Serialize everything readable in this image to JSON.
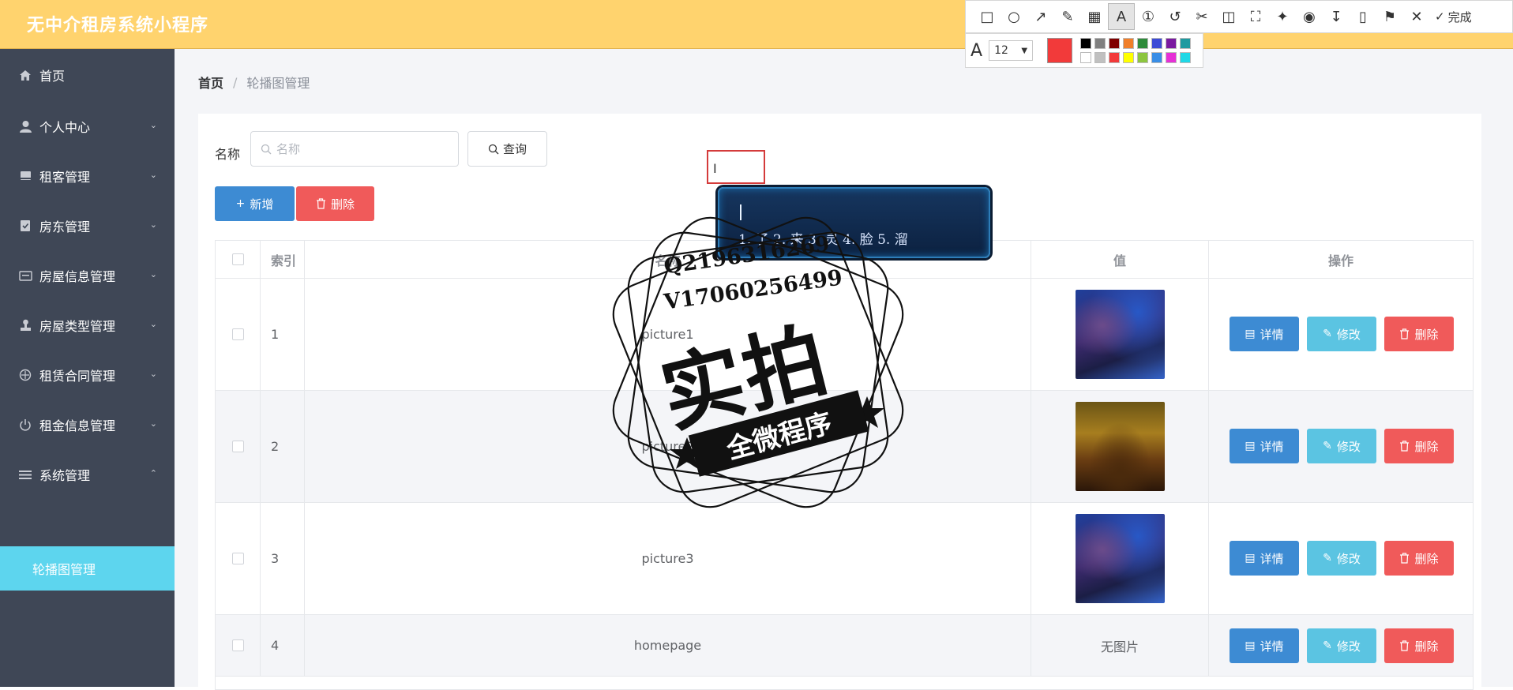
{
  "app": {
    "title": "无中介租房系统小程序"
  },
  "sidebar": {
    "items": [
      {
        "label": "首页",
        "icon": "home-icon",
        "has_children": false
      },
      {
        "label": "个人中心",
        "icon": "user-icon",
        "has_children": true
      },
      {
        "label": "租客管理",
        "icon": "folder-icon",
        "has_children": true
      },
      {
        "label": "房东管理",
        "icon": "checklist-icon",
        "has_children": true
      },
      {
        "label": "房屋信息管理",
        "icon": "card-icon",
        "has_children": true
      },
      {
        "label": "房屋类型管理",
        "icon": "stamp-icon",
        "has_children": true
      },
      {
        "label": "租赁合同管理",
        "icon": "compass-icon",
        "has_children": true
      },
      {
        "label": "租金信息管理",
        "icon": "power-icon",
        "has_children": true
      },
      {
        "label": "系统管理",
        "icon": "menu-icon",
        "has_children": true,
        "expanded": true
      }
    ],
    "active_sub": "轮播图管理"
  },
  "breadcrumb": {
    "home": "首页",
    "separator": "/",
    "current": "轮播图管理"
  },
  "search": {
    "label": "名称",
    "placeholder": "名称",
    "value": "",
    "button": "查询"
  },
  "actions": {
    "add": "新增",
    "delete": "删除"
  },
  "table": {
    "headers": {
      "index": "索引",
      "name": "名称",
      "value": "值",
      "ops": "操作"
    },
    "rows": [
      {
        "index": "1",
        "name": "picture1",
        "value_type": "image",
        "thumb": "night-building"
      },
      {
        "index": "2",
        "name": "picture2",
        "value_type": "image",
        "thumb": "golden-city"
      },
      {
        "index": "3",
        "name": "picture3",
        "value_type": "image",
        "thumb": "night-building"
      },
      {
        "index": "4",
        "name": "homepage",
        "value_type": "text",
        "value": "无图片"
      }
    ],
    "row_buttons": {
      "detail": "详情",
      "edit": "修改",
      "delete": "删除"
    }
  },
  "snip_tool": {
    "font_size": "12",
    "done": "完成",
    "current_color": "#f23a3a",
    "palette": [
      "#000000",
      "#808080",
      "#800000",
      "#f07f2a",
      "#2e8b3a",
      "#3c4bd6",
      "#7a1aa0",
      "#1e9aa0",
      "#ffffff",
      "#c0c0c0",
      "#f23a3a",
      "#ffff00",
      "#8dc63f",
      "#3a8ee6",
      "#e630d6",
      "#20d8e6"
    ]
  },
  "ime": {
    "candidates": "1. 了  2. 来  3. 灵  4. 脸  5. 溜"
  },
  "watermark": {
    "contact_q": "Q2196316269",
    "contact_v": "V17060256499",
    "main": "实拍",
    "ribbon": "全微程序"
  },
  "colors": {
    "header_bg": "#ffd36e",
    "sidebar_bg": "#3f4756",
    "active_sub_bg": "#5dd5ee",
    "primary": "#3d8bd3",
    "info": "#5bc4e2",
    "danger": "#f05a5a"
  }
}
